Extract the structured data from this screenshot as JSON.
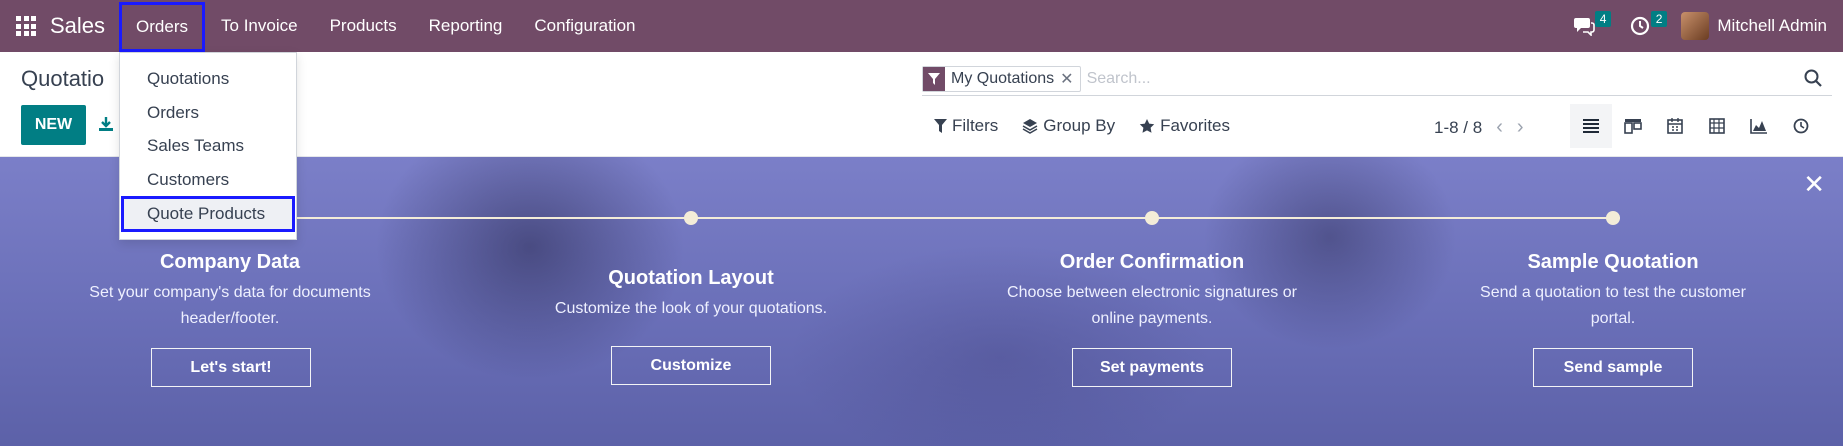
{
  "navbar": {
    "brand": "Sales",
    "menu": [
      {
        "label": "Orders",
        "active": true
      },
      {
        "label": "To Invoice"
      },
      {
        "label": "Products"
      },
      {
        "label": "Reporting"
      },
      {
        "label": "Configuration"
      }
    ],
    "messages_badge": "4",
    "activities_badge": "2",
    "user_name": "Mitchell Admin",
    "bg_color": "#714b67"
  },
  "dropdown": {
    "items": [
      "Quotations",
      "Orders",
      "Sales Teams",
      "Customers",
      "Quote Products"
    ],
    "highlighted": "Quote Products"
  },
  "control_panel": {
    "title": "Quotatio",
    "new_label": "NEW",
    "search": {
      "facet": "My Quotations",
      "placeholder": "Search..."
    },
    "filters_label": "Filters",
    "group_by_label": "Group By",
    "favorites_label": "Favorites",
    "pager": "1-8 / 8",
    "views": [
      "list-view-icon",
      "kanban-view-icon",
      "calendar-view-icon",
      "pivot-view-icon",
      "graph-view-icon",
      "activity-view-icon"
    ]
  },
  "banner": {
    "steps": [
      {
        "title": "Company Data",
        "desc": "Set your company's data for documents header/footer.",
        "button": "Let's start!"
      },
      {
        "title": "Quotation Layout",
        "desc": "Customize the look of your quotations.",
        "button": "Customize"
      },
      {
        "title": "Order Confirmation",
        "desc": "Choose between electronic signatures or online payments.",
        "button": "Set payments"
      },
      {
        "title": "Sample Quotation",
        "desc": "Send a quotation to test the customer portal.",
        "button": "Send sample"
      }
    ]
  },
  "colors": {
    "primary": "#017e84",
    "brand": "#714b67"
  }
}
